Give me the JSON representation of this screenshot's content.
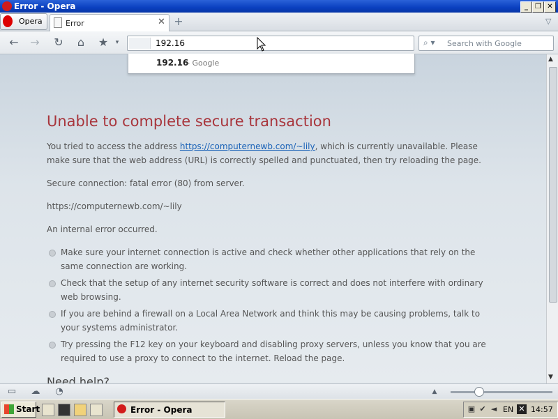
{
  "window": {
    "title": "Error - Opera"
  },
  "tabbar": {
    "menu_label": "Opera",
    "tab_label": "Error",
    "new_tab_symbol": "+"
  },
  "toolbar": {
    "address_value": "192.16",
    "search_placeholder": "Search with Google"
  },
  "suggestion": {
    "query": "192.16",
    "source": " - Google"
  },
  "page": {
    "heading": "Unable to complete secure transaction",
    "intro_before": "You tried to access the address ",
    "intro_link": "https://computernewb.com/~lily",
    "intro_after": ", which is currently unavailable. Please make sure that the web address (URL) is correctly spelled and punctuated, then try reloading the page.",
    "secure_error": "Secure connection: fatal error (80) from server.",
    "url_line": "https://computernewb.com/~lily",
    "internal_error": "An internal error occurred.",
    "bullets": [
      "Make sure your internet connection is active and check whether other applications that rely on the same connection are working.",
      "Check that the setup of any internet security software is correct and does not interfere with ordinary web browsing.",
      "If you are behind a firewall on a Local Area Network and think this may be causing problems, talk to your systems administrator.",
      "Try pressing the F12 key on your keyboard and disabling proxy servers, unless you know that you are required to use a proxy to connect to the internet. Reload the page."
    ],
    "need_help": "Need help?"
  },
  "taskbar": {
    "start_label": "Start",
    "task_label": "Error - Opera",
    "language": "EN",
    "clock": "14:57"
  },
  "colors": {
    "heading": "#a8353c",
    "link": "#1a62b7",
    "titlebar": "#0a40c0"
  },
  "icons": [
    "opera-logo-icon",
    "page-icon",
    "close-icon",
    "back-icon",
    "forward-icon",
    "reload-icon",
    "home-icon",
    "bookmark-star-icon",
    "search-icon",
    "panel-icon",
    "cloud-icon",
    "speed-dial-icon",
    "windows-logo-icon"
  ]
}
